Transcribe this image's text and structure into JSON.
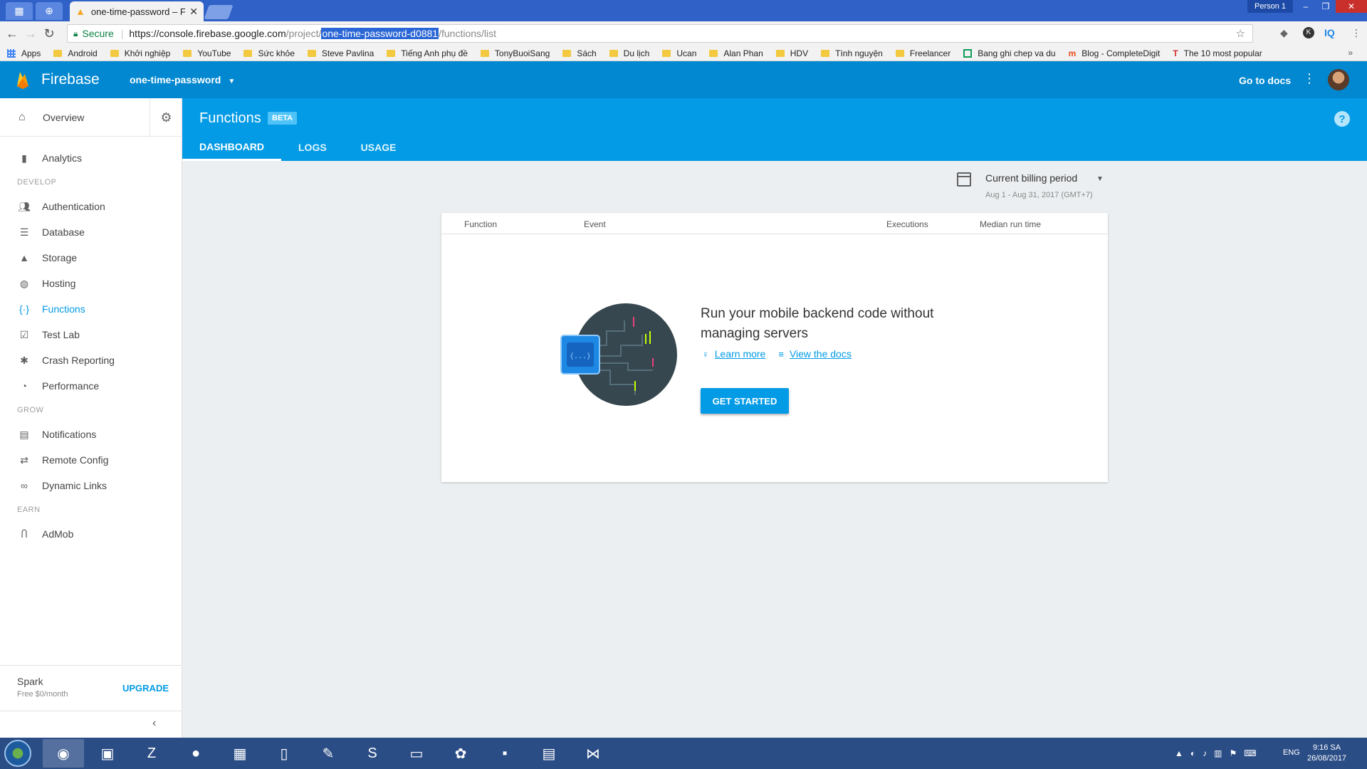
{
  "browser": {
    "tab_title": "one-time-password – Fu",
    "person": "Person 1",
    "secure_label": "Secure",
    "url_host": "https://console.firebase.google.com",
    "url_path_prefix": "/project/",
    "url_highlight": "one-time-password-d0881",
    "url_path_suffix": "/functions/list",
    "bookmarks": [
      "Apps",
      "Android",
      "Khởi nghiệp",
      "YouTube",
      "Sức khỏe",
      "Steve Pavlina",
      "Tiếng Anh phụ đề",
      "TonyBuoiSang",
      "Sách",
      "Du lịch",
      "Ucan",
      "Alan Phan",
      "HDV",
      "Tình nguyện",
      "Freelancer",
      "Bang ghi chep va du",
      "Blog - CompleteDigit",
      "The 10 most popular"
    ],
    "bookmarks_more": "»"
  },
  "header": {
    "brand": "Firebase",
    "project": "one-time-password",
    "docs": "Go to docs"
  },
  "sidebar": {
    "overview": "Overview",
    "analytics": "Analytics",
    "sections": {
      "develop": "DEVELOP",
      "grow": "GROW",
      "earn": "EARN"
    },
    "develop_items": [
      "Authentication",
      "Database",
      "Storage",
      "Hosting",
      "Functions",
      "Test Lab",
      "Crash Reporting",
      "Performance"
    ],
    "grow_items": [
      "Notifications",
      "Remote Config",
      "Dynamic Links"
    ],
    "earn_items": [
      "AdMob"
    ],
    "plan_name": "Spark",
    "plan_price": "Free $0/month",
    "upgrade": "UPGRADE"
  },
  "page": {
    "title": "Functions",
    "badge": "BETA",
    "tabs": [
      "DASHBOARD",
      "LOGS",
      "USAGE"
    ],
    "billing_label": "Current billing period",
    "billing_range": "Aug 1 - Aug 31, 2017 (GMT+7)"
  },
  "table": {
    "columns": [
      "Function",
      "Event",
      "Executions",
      "Median run time"
    ]
  },
  "empty": {
    "title": "Run your mobile backend code without managing servers",
    "learn_more": "Learn more",
    "view_docs": "View the docs",
    "cta": "GET STARTED",
    "chip_label": "{...}"
  },
  "taskbar": {
    "lang": "ENG",
    "time": "9:16 SA",
    "date": "26/08/2017"
  },
  "colors": {
    "firebase_blue": "#0288d1",
    "accent": "#039be5",
    "taskbar": "#2b4d86"
  }
}
